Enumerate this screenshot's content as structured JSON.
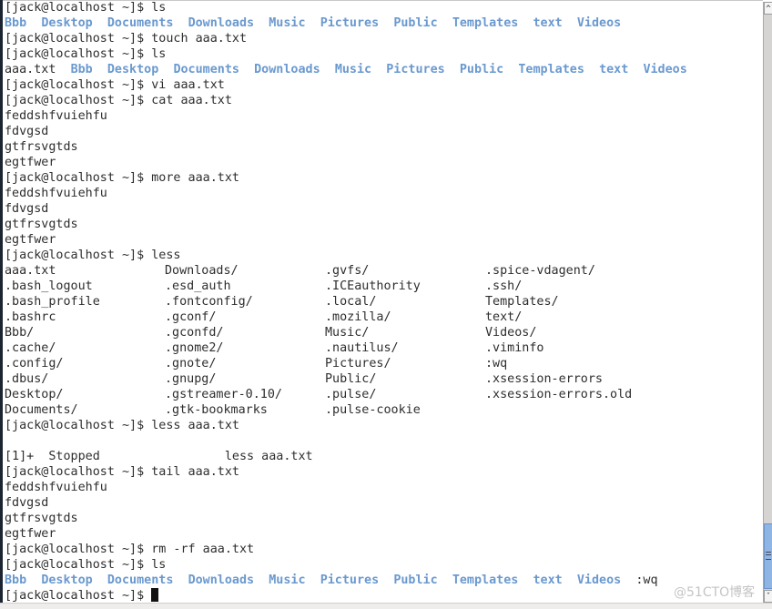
{
  "terminal": {
    "prompt": "[jack@localhost ~]$ ",
    "lines": [
      {
        "type": "cmd",
        "text": "ls"
      },
      {
        "type": "ls",
        "plain": "",
        "dirs": [
          "Bbb",
          "Desktop",
          "Documents",
          "Downloads",
          "Music",
          "Pictures",
          "Public",
          "Templates",
          "text",
          "Videos"
        ],
        "trailing": ""
      },
      {
        "type": "cmd",
        "text": "touch aaa.txt"
      },
      {
        "type": "cmd",
        "text": "ls"
      },
      {
        "type": "ls",
        "plain": "aaa.txt",
        "dirs": [
          "Bbb",
          "Desktop",
          "Documents",
          "Downloads",
          "Music",
          "Pictures",
          "Public",
          "Templates",
          "text",
          "Videos"
        ],
        "trailing": ""
      },
      {
        "type": "cmd",
        "text": "vi aaa.txt"
      },
      {
        "type": "cmd",
        "text": "cat aaa.txt"
      },
      {
        "type": "out",
        "text": "feddshfvuiehfu"
      },
      {
        "type": "out",
        "text": "fdvgsd"
      },
      {
        "type": "out",
        "text": "gtfrsvgtds"
      },
      {
        "type": "out",
        "text": "egtfwer"
      },
      {
        "type": "cmd",
        "text": "more aaa.txt"
      },
      {
        "type": "out",
        "text": "feddshfvuiehfu"
      },
      {
        "type": "out",
        "text": "fdvgsd"
      },
      {
        "type": "out",
        "text": "gtfrsvgtds"
      },
      {
        "type": "out",
        "text": "egtfwer"
      },
      {
        "type": "cmd",
        "text": "less"
      },
      {
        "type": "grid",
        "cols": [
          "aaa.txt",
          "Downloads/",
          ".gvfs/",
          ".spice-vdagent/"
        ]
      },
      {
        "type": "grid",
        "cols": [
          ".bash_logout",
          ".esd_auth",
          ".ICEauthority",
          ".ssh/"
        ]
      },
      {
        "type": "grid",
        "cols": [
          ".bash_profile",
          ".fontconfig/",
          ".local/",
          "Templates/"
        ]
      },
      {
        "type": "grid",
        "cols": [
          ".bashrc",
          ".gconf/",
          ".mozilla/",
          "text/"
        ]
      },
      {
        "type": "grid",
        "cols": [
          "Bbb/",
          ".gconfd/",
          "Music/",
          "Videos/"
        ]
      },
      {
        "type": "grid",
        "cols": [
          ".cache/",
          ".gnome2/",
          ".nautilus/",
          ".viminfo"
        ]
      },
      {
        "type": "grid",
        "cols": [
          ".config/",
          ".gnote/",
          "Pictures/",
          ":wq"
        ]
      },
      {
        "type": "grid",
        "cols": [
          ".dbus/",
          ".gnupg/",
          "Public/",
          ".xsession-errors"
        ]
      },
      {
        "type": "grid",
        "cols": [
          "Desktop/",
          ".gstreamer-0.10/",
          ".pulse/",
          ".xsession-errors.old"
        ]
      },
      {
        "type": "grid",
        "cols": [
          "Documents/",
          ".gtk-bookmarks",
          ".pulse-cookie",
          ""
        ]
      },
      {
        "type": "cmd",
        "text": "less aaa.txt"
      },
      {
        "type": "out",
        "text": ""
      },
      {
        "type": "out",
        "text": "[1]+  Stopped                 less aaa.txt"
      },
      {
        "type": "cmd",
        "text": "tail aaa.txt"
      },
      {
        "type": "out",
        "text": "feddshfvuiehfu"
      },
      {
        "type": "out",
        "text": "fdvgsd"
      },
      {
        "type": "out",
        "text": "gtfrsvgtds"
      },
      {
        "type": "out",
        "text": "egtfwer"
      },
      {
        "type": "cmd",
        "text": "rm -rf aaa.txt"
      },
      {
        "type": "cmd",
        "text": "ls"
      },
      {
        "type": "ls",
        "plain": "",
        "dirs": [
          "Bbb",
          "Desktop",
          "Documents",
          "Downloads",
          "Music",
          "Pictures",
          "Public",
          "Templates",
          "text",
          "Videos"
        ],
        "trailing": ":wq"
      },
      {
        "type": "current",
        "text": ""
      }
    ]
  },
  "scrollbar": {
    "up_icon": "chevron-up-icon",
    "down_icon": "chevron-down-icon",
    "position_fraction": 1.0
  },
  "colors": {
    "directory": "#6a99cf",
    "text": "#2e2e2e",
    "background": "#ffffff",
    "scroll_thumb": "#8fb5e4"
  },
  "watermark": "@51CTO博客"
}
